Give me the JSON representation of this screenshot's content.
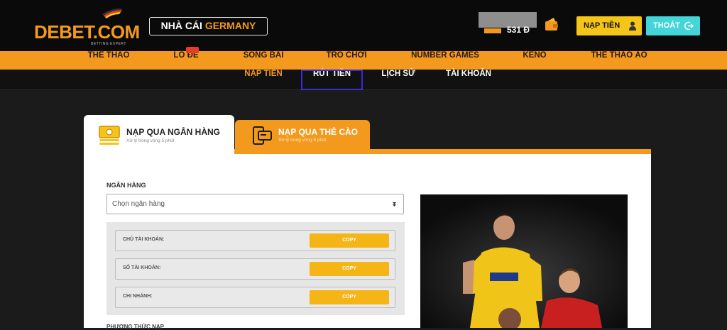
{
  "header": {
    "logo_text": "DEBET.COM",
    "logo_sub": "BETTING EXPERT",
    "badge_prefix": "NHÀ CÁI",
    "badge_accent": "GERMANY",
    "balance": "531 Đ",
    "deposit_label": "NẠP TIỀN",
    "logout_label": "THOÁT"
  },
  "main_nav": [
    {
      "label": "THỂ THAO"
    },
    {
      "label": "LÔ ĐỀ"
    },
    {
      "label": "SÒNG BÀI"
    },
    {
      "label": "TRÒ CHƠI"
    },
    {
      "label": "NUMBER GAMES"
    },
    {
      "label": "KENO"
    },
    {
      "label": "THỂ THAO ẢO"
    }
  ],
  "sub_nav": [
    {
      "label": "NẠP TIỀN"
    },
    {
      "label": "RÚT TIỀN"
    },
    {
      "label": "LỊCH SỬ"
    },
    {
      "label": "TÀI KHOẢN"
    }
  ],
  "tabs": [
    {
      "title": "NẠP QUA NGÂN HÀNG",
      "subtitle": "Xử lý trong vòng 5 phút"
    },
    {
      "title": "NẠP QUA THẺ CÀO",
      "subtitle": "Xử lý trong vòng 5 phút"
    }
  ],
  "form": {
    "bank_label": "NGÂN HÀNG",
    "bank_select_value": "Chọn ngân hàng",
    "rows": [
      {
        "label": "CHỦ TÀI KHOẢN:",
        "copy": "COPY"
      },
      {
        "label": "SỐ TÀI KHOẢN:",
        "copy": "COPY"
      },
      {
        "label": "CHI NHÁNH:",
        "copy": "COPY"
      }
    ],
    "cut_label": "PHƯƠNG THỨC NẠP"
  },
  "colors": {
    "brand_orange": "#f39a1e",
    "deposit_yellow": "#f5c518",
    "logout_cyan": "#44d5d8",
    "selected_outline": "#3b2bd9"
  },
  "icons": [
    "wallet-icon",
    "user-icon",
    "logout-icon",
    "bank-icon",
    "card-icon",
    "caret-icon"
  ]
}
